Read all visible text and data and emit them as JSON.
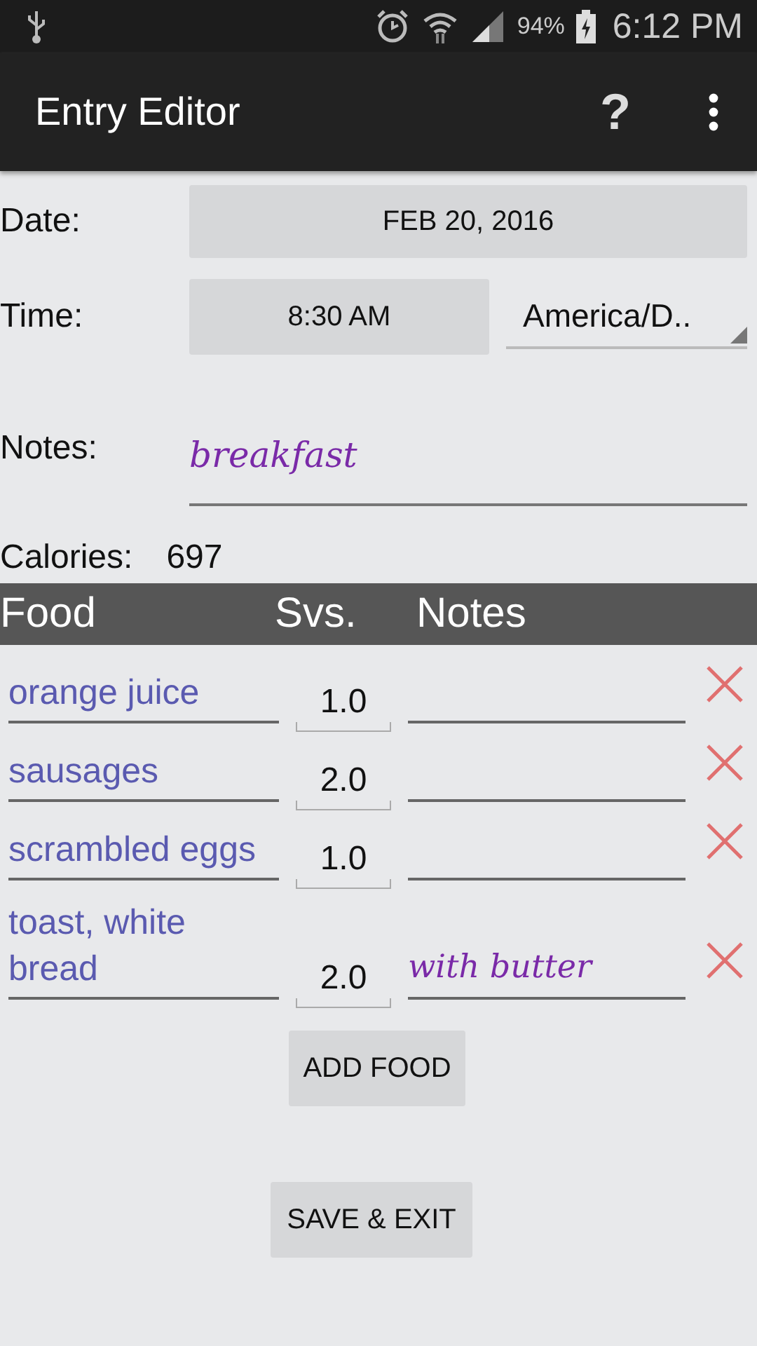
{
  "status_bar": {
    "battery": "94%",
    "time": "6:12 PM"
  },
  "app_bar": {
    "title": "Entry Editor",
    "help": "?"
  },
  "form": {
    "date_label": "Date:",
    "date": "FEB 20, 2016",
    "time_label": "Time:",
    "time": "8:30 AM",
    "timezone": "America/D..",
    "notes_label": "Notes:",
    "notes": "breakfast",
    "calories_label": "Calories:",
    "calories": "697"
  },
  "table": {
    "columns": [
      "Food",
      "Svs.",
      "Notes"
    ],
    "rows": [
      {
        "food": "orange juice",
        "servings": "1.0"
      },
      {
        "food": "sausages",
        "servings": "2.0"
      },
      {
        "food": "scrambled eggs",
        "servings": "1.0"
      },
      {
        "food": "toast, white bread",
        "servings": "2.0",
        "notes": "with butter"
      }
    ]
  },
  "buttons": {
    "add": "ADD FOOD",
    "save": "SAVE & EXIT"
  }
}
